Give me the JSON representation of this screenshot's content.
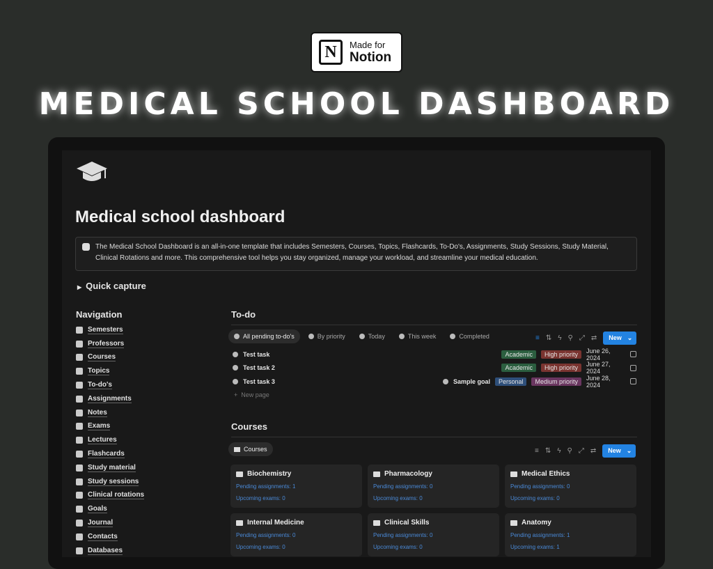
{
  "badge": {
    "line1": "Made for",
    "line2": "Notion",
    "logo": "N"
  },
  "hero": "MEDICAL SCHOOL DASHBOARD",
  "page": {
    "icon": "graduation-cap-icon",
    "title": "Medical school dashboard",
    "callout": "The Medical School Dashboard is an all-in-one template that includes Semesters, Courses, Topics, Flashcards, To-Do's, Assignments, Study Sessions, Study Material, Clinical Rotations and more. This comprehensive tool helps you stay organized, manage your workload, and streamline your medical education.",
    "quick_capture": "Quick capture"
  },
  "nav": {
    "title": "Navigation",
    "items": [
      "Semesters",
      "Professors",
      "Courses",
      "Topics",
      "To-do's",
      "Assignments",
      "Notes",
      "Exams",
      "Lectures",
      "Flashcards",
      "Study material",
      "Study sessions",
      "Clinical rotations",
      "Goals",
      "Journal",
      "Contacts",
      "Databases"
    ]
  },
  "todo": {
    "title": "To-do",
    "tabs": [
      "All pending to-do's",
      "By priority",
      "Today",
      "This week",
      "Completed"
    ],
    "new": "New",
    "rows": [
      {
        "name": "Test task",
        "goal": "",
        "cat": "Academic",
        "pri": "High priority",
        "date": "June 26, 2024"
      },
      {
        "name": "Test task 2",
        "goal": "",
        "cat": "Academic",
        "pri": "High priority",
        "date": "June 27, 2024"
      },
      {
        "name": "Test task 3",
        "goal": "Sample goal",
        "cat": "Personal",
        "pri": "Medium priority",
        "date": "June 28, 2024"
      }
    ],
    "new_page": "New page"
  },
  "colors": {
    "Academic": "#2b5e3f",
    "Personal": "#2e4f7a",
    "High priority": "#7a3430",
    "Medium priority": "#6a3660",
    "accent": "#2383e2"
  },
  "courses": {
    "title": "Courses",
    "tab": "Courses",
    "new": "New",
    "cards": [
      {
        "name": "Biochemistry",
        "pending": "Pending assignments: 1",
        "exams": "Upcoming exams: 0"
      },
      {
        "name": "Pharmacology",
        "pending": "Pending assignments: 0",
        "exams": "Upcoming exams: 0"
      },
      {
        "name": "Medical Ethics",
        "pending": "Pending assignments: 0",
        "exams": "Upcoming exams: 0"
      },
      {
        "name": "Internal Medicine",
        "pending": "Pending assignments: 0",
        "exams": "Upcoming exams: 0"
      },
      {
        "name": "Clinical Skills",
        "pending": "Pending assignments: 0",
        "exams": "Upcoming exams: 0"
      },
      {
        "name": "Anatomy",
        "pending": "Pending assignments: 1",
        "exams": "Upcoming exams: 1"
      }
    ]
  }
}
